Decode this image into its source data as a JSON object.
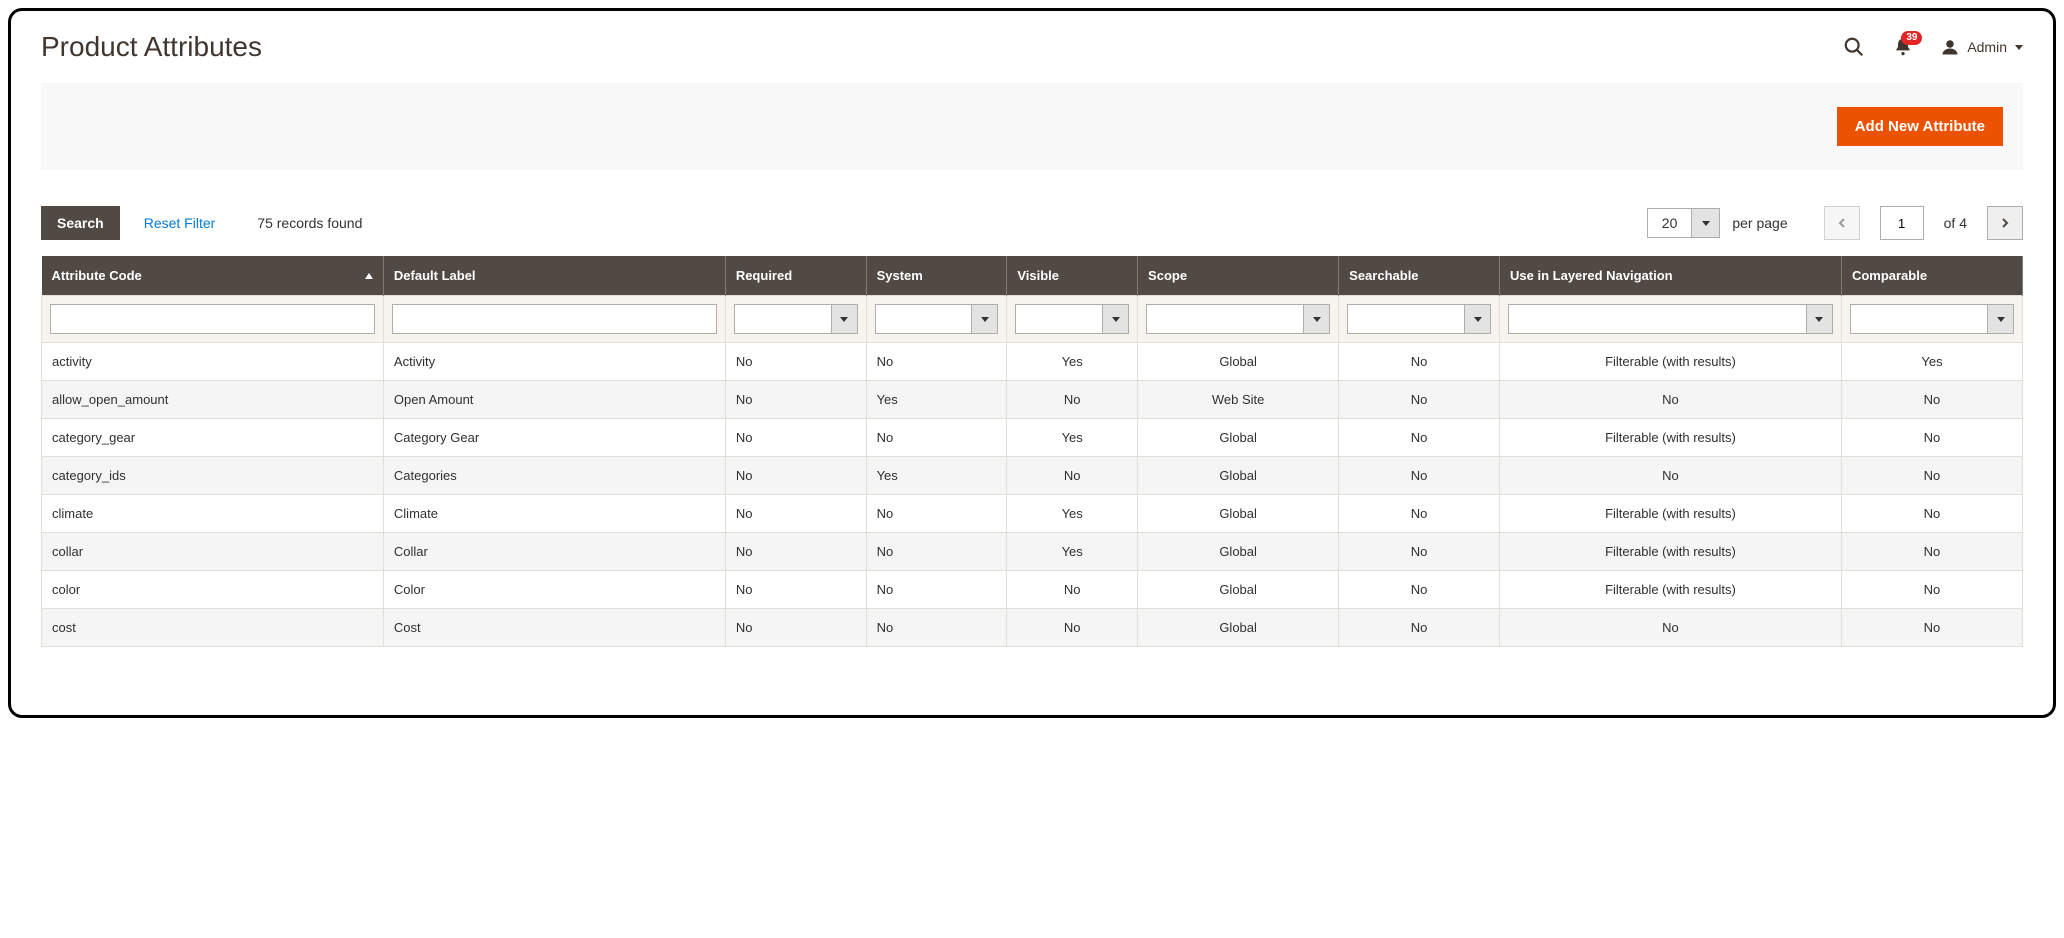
{
  "page_title": "Product Attributes",
  "header": {
    "notification_count": "39",
    "user_name": "Admin"
  },
  "action_bar": {
    "add_button": "Add New Attribute"
  },
  "toolbar": {
    "search_label": "Search",
    "reset_label": "Reset Filter",
    "records_found": "75 records found",
    "page_size": "20",
    "per_page_label": "per page",
    "current_page": "1",
    "of_pages": "of 4"
  },
  "columns": [
    "Attribute Code",
    "Default Label",
    "Required",
    "System",
    "Visible",
    "Scope",
    "Searchable",
    "Use in Layered Navigation",
    "Comparable"
  ],
  "rows": [
    {
      "code": "activity",
      "label": "Activity",
      "required": "No",
      "system": "No",
      "visible": "Yes",
      "scope": "Global",
      "searchable": "No",
      "layered": "Filterable (with results)",
      "comparable": "Yes"
    },
    {
      "code": "allow_open_amount",
      "label": "Open Amount",
      "required": "No",
      "system": "Yes",
      "visible": "No",
      "scope": "Web Site",
      "searchable": "No",
      "layered": "No",
      "comparable": "No"
    },
    {
      "code": "category_gear",
      "label": "Category Gear",
      "required": "No",
      "system": "No",
      "visible": "Yes",
      "scope": "Global",
      "searchable": "No",
      "layered": "Filterable (with results)",
      "comparable": "No"
    },
    {
      "code": "category_ids",
      "label": "Categories",
      "required": "No",
      "system": "Yes",
      "visible": "No",
      "scope": "Global",
      "searchable": "No",
      "layered": "No",
      "comparable": "No"
    },
    {
      "code": "climate",
      "label": "Climate",
      "required": "No",
      "system": "No",
      "visible": "Yes",
      "scope": "Global",
      "searchable": "No",
      "layered": "Filterable (with results)",
      "comparable": "No"
    },
    {
      "code": "collar",
      "label": "Collar",
      "required": "No",
      "system": "No",
      "visible": "Yes",
      "scope": "Global",
      "searchable": "No",
      "layered": "Filterable (with results)",
      "comparable": "No"
    },
    {
      "code": "color",
      "label": "Color",
      "required": "No",
      "system": "No",
      "visible": "No",
      "scope": "Global",
      "searchable": "No",
      "layered": "Filterable (with results)",
      "comparable": "No"
    },
    {
      "code": "cost",
      "label": "Cost",
      "required": "No",
      "system": "No",
      "visible": "No",
      "scope": "Global",
      "searchable": "No",
      "layered": "No",
      "comparable": "No"
    }
  ]
}
